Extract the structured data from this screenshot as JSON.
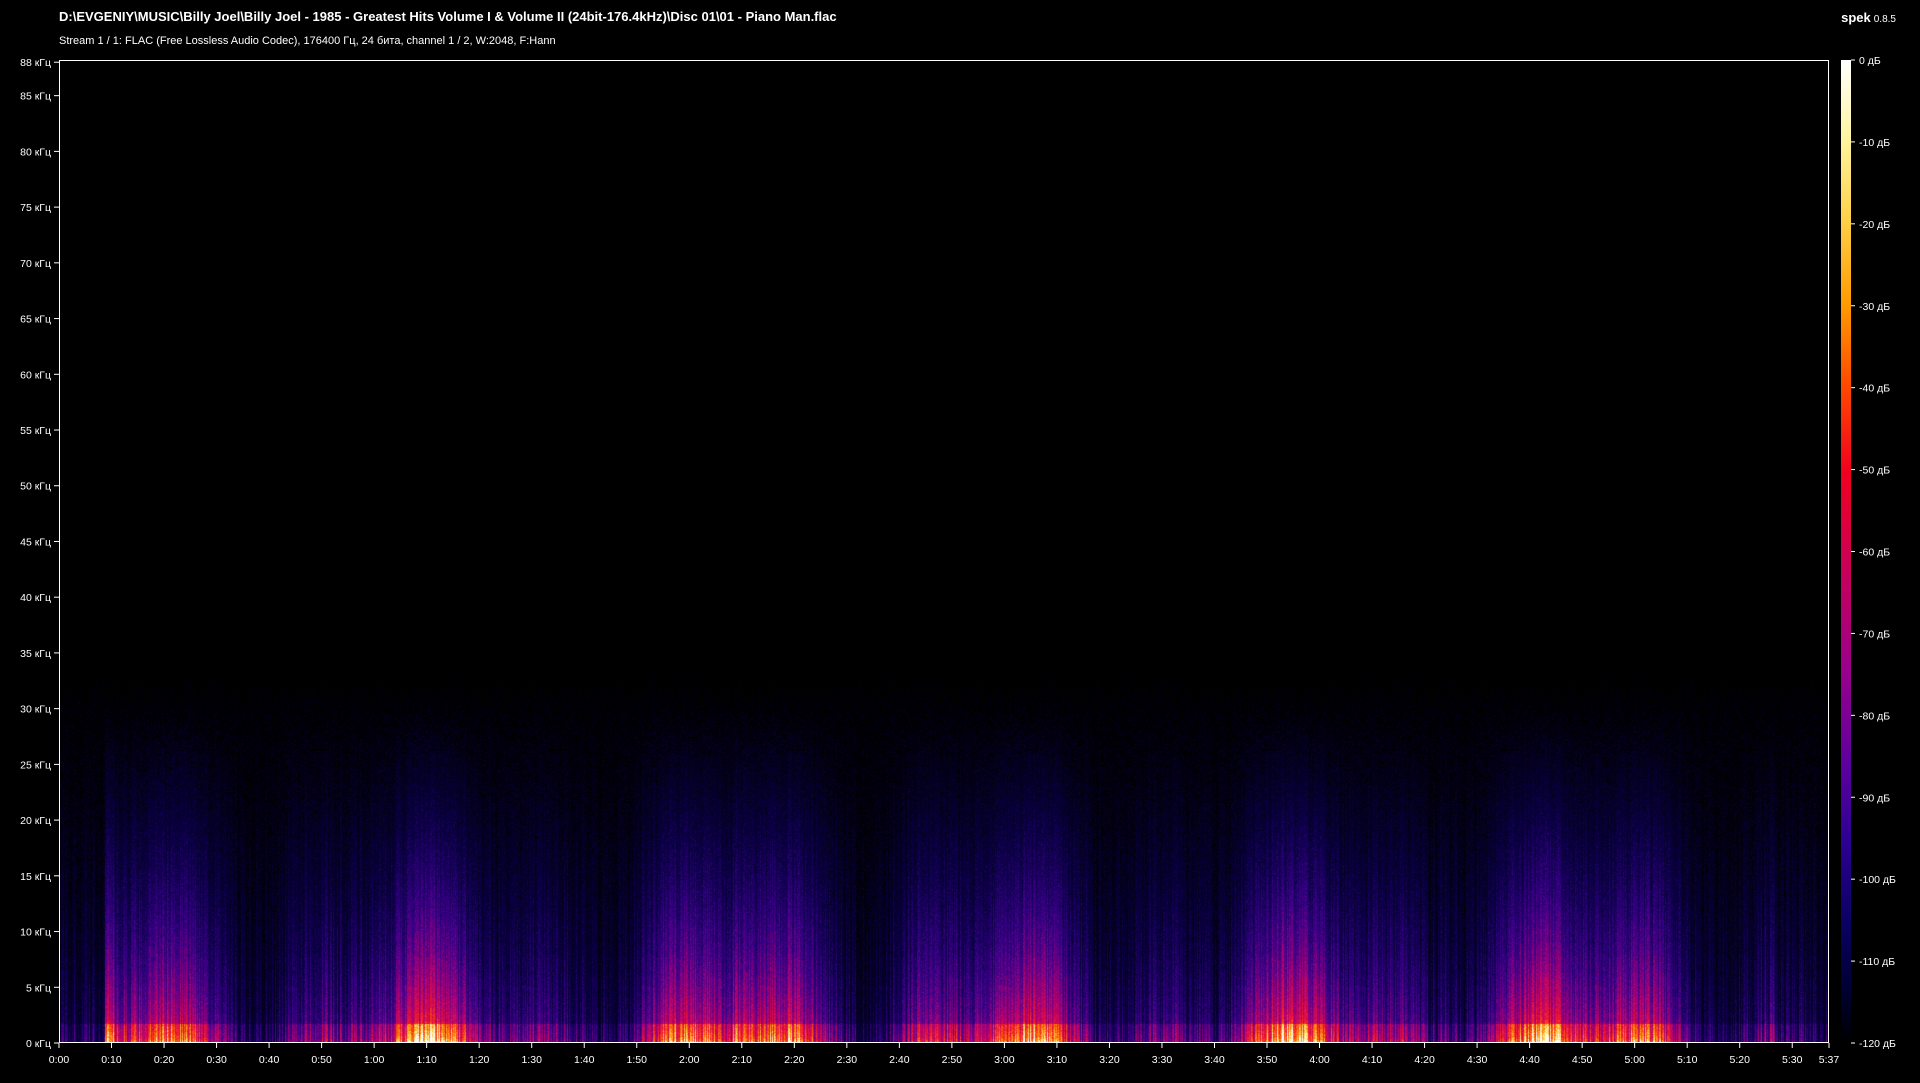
{
  "header": {
    "file_path": "D:\\EVGENIY\\MUSIC\\Billy Joel\\Billy Joel - 1985 - Greatest Hits Volume I & Volume II (24bit-176.4kHz)\\Disc 01\\01 - Piano Man.flac",
    "stream_info": "Stream 1 / 1: FLAC (Free Lossless Audio Codec), 176400 Гц, 24 бита, channel 1 / 2, W:2048, F:Hann",
    "app_name": "spek",
    "app_version": "0.8.5"
  },
  "frequency_axis": {
    "labels": [
      "0 кГц",
      "5 кГц",
      "10 кГц",
      "15 кГц",
      "20 кГц",
      "25 кГц",
      "30 кГц",
      "35 кГц",
      "40 кГц",
      "45 кГц",
      "50 кГц",
      "55 кГц",
      "60 кГц",
      "65 кГц",
      "70 кГц",
      "75 кГц",
      "80 кГц",
      "85 кГц",
      "88 кГц"
    ],
    "values_khz": [
      0,
      5,
      10,
      15,
      20,
      25,
      30,
      35,
      40,
      45,
      50,
      55,
      60,
      65,
      70,
      75,
      80,
      85,
      88
    ],
    "max_khz": 88.2
  },
  "time_axis": {
    "labels": [
      "0:00",
      "0:10",
      "0:20",
      "0:30",
      "0:40",
      "0:50",
      "1:00",
      "1:10",
      "1:20",
      "1:30",
      "1:40",
      "1:50",
      "2:00",
      "2:10",
      "2:20",
      "2:30",
      "2:40",
      "2:50",
      "3:00",
      "3:10",
      "3:20",
      "3:30",
      "3:40",
      "3:50",
      "4:00",
      "4:10",
      "4:20",
      "4:30",
      "4:40",
      "4:50",
      "5:00",
      "5:10",
      "5:20",
      "5:30",
      "5:37"
    ],
    "values_s": [
      0,
      10,
      20,
      30,
      40,
      50,
      60,
      70,
      80,
      90,
      100,
      110,
      120,
      130,
      140,
      150,
      160,
      170,
      180,
      190,
      200,
      210,
      220,
      230,
      240,
      250,
      260,
      270,
      280,
      290,
      300,
      310,
      320,
      330,
      337
    ],
    "duration_s": 337
  },
  "db_scale": {
    "labels": [
      "0 дБ",
      "-10 дБ",
      "-20 дБ",
      "-30 дБ",
      "-40 дБ",
      "-50 дБ",
      "-60 дБ",
      "-70 дБ",
      "-80 дБ",
      "-90 дБ",
      "-100 дБ",
      "-110 дБ",
      "-120 дБ"
    ],
    "values_db": [
      0,
      -10,
      -20,
      -30,
      -40,
      -50,
      -60,
      -70,
      -80,
      -90,
      -100,
      -110,
      -120
    ],
    "min_db": -120,
    "max_db": 0
  },
  "spectrogram": {
    "cutoff_khz": 31,
    "colors": [
      "#000000",
      "#10005a",
      "#4a0090",
      "#b00070",
      "#f01030",
      "#ff8a00",
      "#ffe060",
      "#ffffff"
    ]
  }
}
